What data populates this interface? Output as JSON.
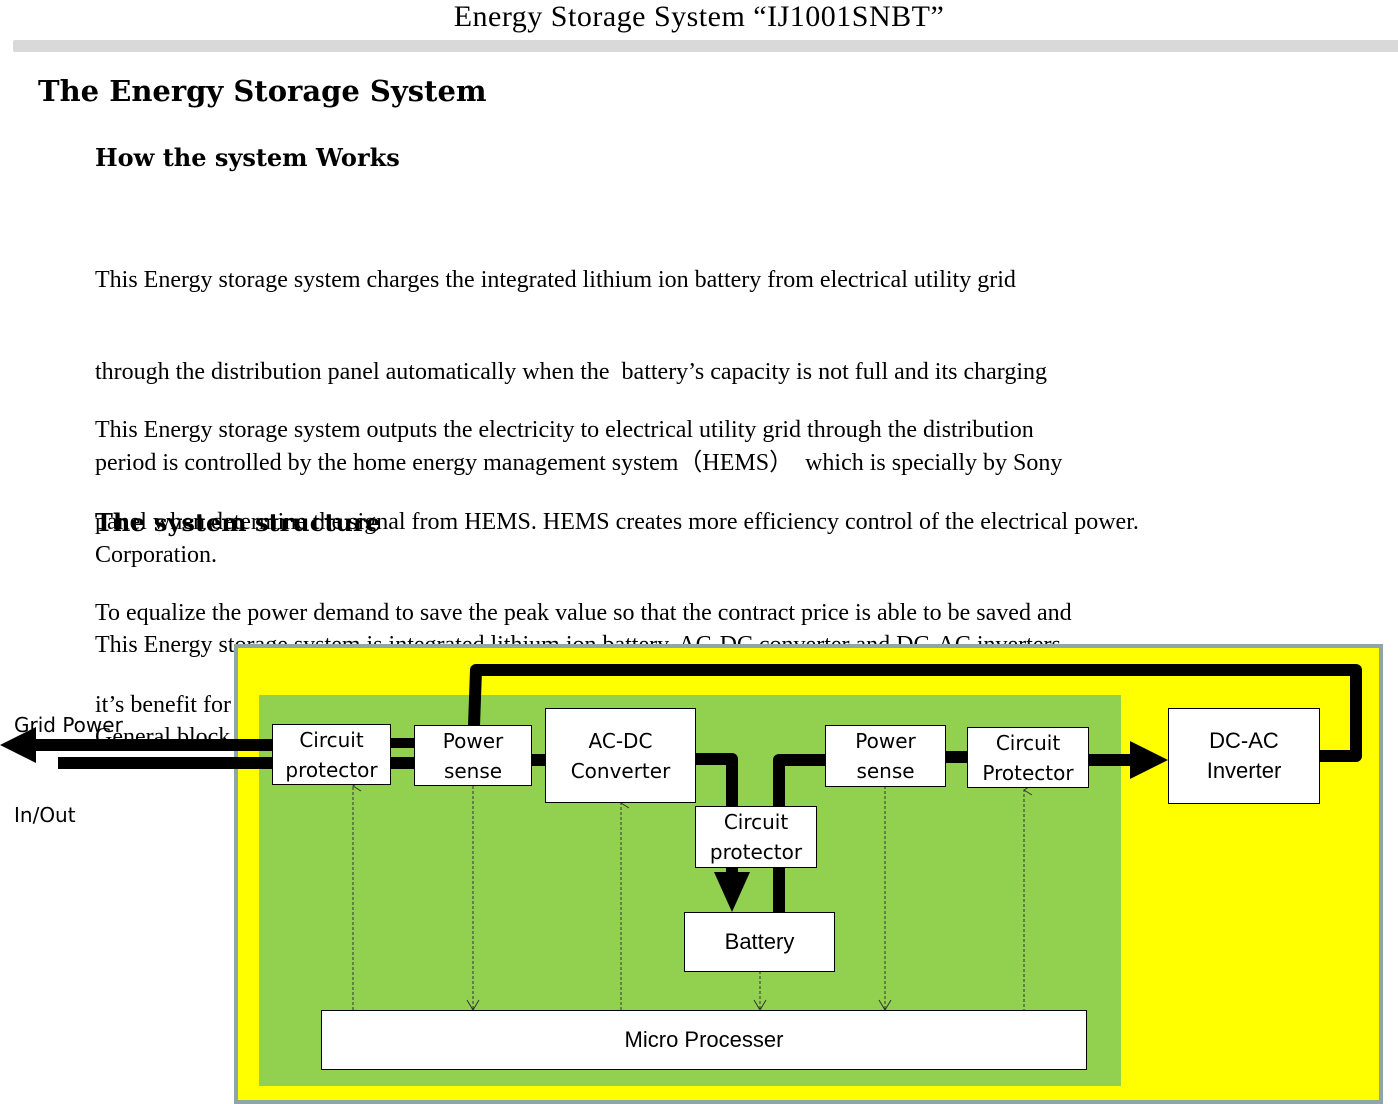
{
  "document": {
    "title": "Energy Storage System “IJ1001SNBT”",
    "heading": "The Energy Storage System",
    "sections": [
      {
        "heading": "How the system Works",
        "paragraphs": [
          {
            "lines": [
              "This Energy storage system charges the integrated lithium ion battery from electrical utility grid",
              "through the distribution panel automatically when the  battery’s capacity is not full and its charging",
              "period is controlled by the home energy management system（HEMS）  which is specially by Sony",
              "Corporation."
            ]
          },
          {
            "lines": [
              "This Energy storage system outputs the electricity to electrical utility grid through the distribution",
              "panel when determine the signal from HEMS. HEMS creates more efficiency control of the electrical power.",
              "To equalize the power demand to save the peak value so that the contract price is able to be saved and",
              "it’s benefit for the house owner."
            ]
          }
        ]
      },
      {
        "heading": "The system structure",
        "paragraphs": [
          {
            "lines": [
              "This Energy storage system is integrated lithium ion battery, AC-DC converter and DC-AC inverters.",
              "General block diagram is bellow."
            ]
          }
        ]
      }
    ]
  },
  "diagram": {
    "colors": {
      "outer_fill": "#ffff00",
      "outer_border": "#8fa6a8",
      "inner_fill": "#92d050",
      "power_line": "#000000",
      "signal_line": "#333333",
      "block_fill": "#ffffff"
    },
    "external_label": [
      "Grid Power",
      "In/Out"
    ],
    "blocks": {
      "circuit_protector_left": [
        "Circuit",
        "protector"
      ],
      "power_sense_left": [
        "Power",
        "sense"
      ],
      "ac_dc_converter": [
        "AC-DC",
        "Converter"
      ],
      "circuit_protector_center": [
        "Circuit",
        "protector"
      ],
      "battery": [
        "Battery"
      ],
      "power_sense_right": [
        "Power",
        "sense"
      ],
      "circuit_protector_right": [
        "Circuit",
        "Protector"
      ],
      "dc_ac_inverter": [
        "DC-AC",
        "Inverter"
      ],
      "micro_processer": [
        "Micro Processer"
      ]
    }
  }
}
